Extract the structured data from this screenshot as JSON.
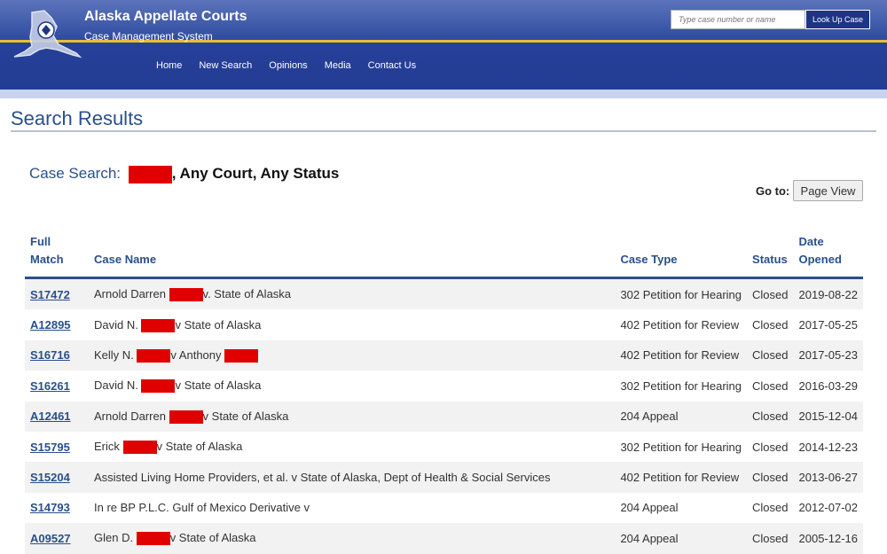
{
  "header": {
    "title": "Alaska Appellate Courts",
    "subtitle": "Case Management System",
    "search_placeholder": "Type case number or name",
    "lookup_label": "Look Up Case",
    "nav": [
      "Home",
      "New Search",
      "Opinions",
      "Media",
      "Contact Us"
    ]
  },
  "main": {
    "page_title": "Search Results",
    "search_label": "Case Search:",
    "search_rest": ", Any Court, Any Status",
    "goto_label": "Go to:",
    "goto_button": "Page View"
  },
  "table": {
    "headers": [
      "Full Match",
      "Case Name",
      "Case Type",
      "Status",
      "Date Opened"
    ],
    "rows": [
      {
        "match": "S17472",
        "name_pre": "Arnold Darren ",
        "name_post": "v. State of Alaska",
        "type": "302 Petition for Hearing",
        "status": "Closed",
        "date": "2019-08-22"
      },
      {
        "match": "A12895",
        "name_pre": "David N. ",
        "name_post": "v State of Alaska",
        "type": "402 Petition for Review",
        "status": "Closed",
        "date": "2017-05-25"
      },
      {
        "match": "S16716",
        "name_pre": "Kelly N. ",
        "name_post": "v Anthony ",
        "type": "402 Petition for Review",
        "status": "Closed",
        "date": "2017-05-23"
      },
      {
        "match": "S16261",
        "name_pre": "David N. ",
        "name_post": "v State of Alaska",
        "type": "302 Petition for Hearing",
        "status": "Closed",
        "date": "2016-03-29"
      },
      {
        "match": "A12461",
        "name_pre": "Arnold Darren ",
        "name_post": "v State of Alaska",
        "type": "204 Appeal",
        "status": "Closed",
        "date": "2015-12-04"
      },
      {
        "match": "S15795",
        "name_pre": "Erick ",
        "name_post": "v State of Alaska",
        "type": "302 Petition for Hearing",
        "status": "Closed",
        "date": "2014-12-23"
      },
      {
        "match": "S15204",
        "name_pre": "Assisted Living Home Providers, et al. v State of Alaska, Dept of Health & Social Services",
        "name_post": "",
        "type": "402 Petition for Review",
        "status": "Closed",
        "date": "2013-06-27"
      },
      {
        "match": "S14793",
        "name_pre": "In re BP P.L.C. Gulf of Mexico Derivative v",
        "name_post": "",
        "type": "204 Appeal",
        "status": "Closed",
        "date": "2012-07-02"
      },
      {
        "match": "A09527",
        "name_pre": "Glen D. ",
        "name_post": "v State of Alaska",
        "type": "204 Appeal",
        "status": "Closed",
        "date": "2005-12-16"
      }
    ]
  }
}
